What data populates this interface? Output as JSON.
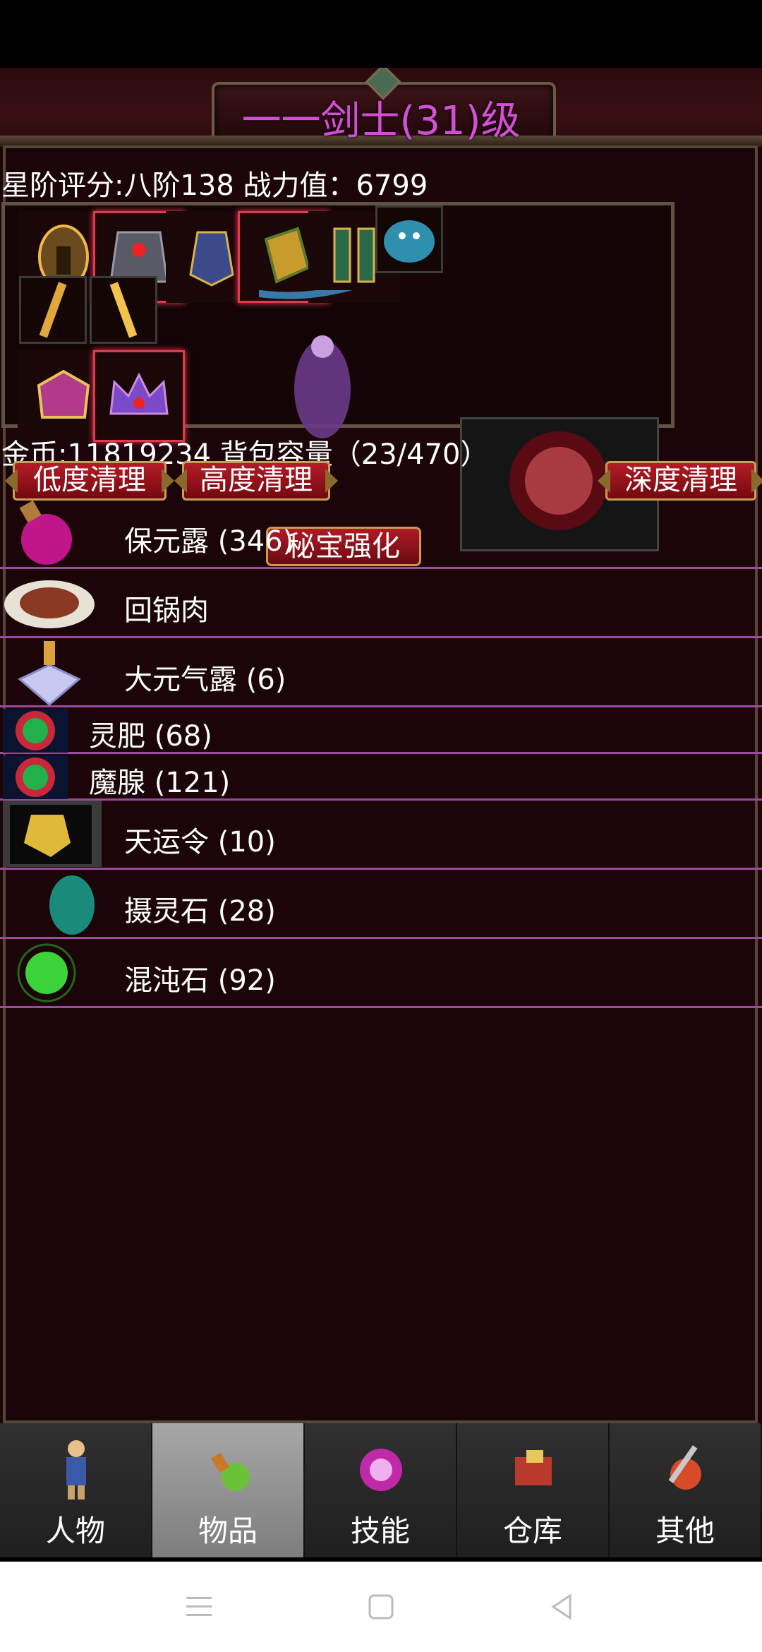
{
  "title": {
    "text": "一一剑士(31)级"
  },
  "stats": {
    "text": "星阶评分:八阶138 战力值：6799"
  },
  "equipment": {
    "secret_button": "秘宝强化"
  },
  "inventory": {
    "gold_capacity": "金币:11819234 背包容量（23/470）"
  },
  "cleanup": {
    "low": "低度清理",
    "high": "高度清理",
    "deep": "深度清理"
  },
  "items": [
    {
      "name": "保元露 (346)"
    },
    {
      "name": "回锅肉"
    },
    {
      "name": "大元气露 (6)"
    },
    {
      "name": "灵肥 (68)"
    },
    {
      "name": "魔腺 (121)"
    },
    {
      "name": "天运令 (10)"
    },
    {
      "name": "摄灵石 (28)"
    },
    {
      "name": "混沌石 (92)"
    }
  ],
  "nav": {
    "tabs": [
      {
        "label": "人物"
      },
      {
        "label": "物品"
      },
      {
        "label": "技能"
      },
      {
        "label": "仓库"
      },
      {
        "label": "其他"
      }
    ],
    "active_index": 1
  },
  "colors": {
    "accent": "#d44fd6",
    "divider": "#9b4aa0",
    "button_red": "#b01a26"
  }
}
